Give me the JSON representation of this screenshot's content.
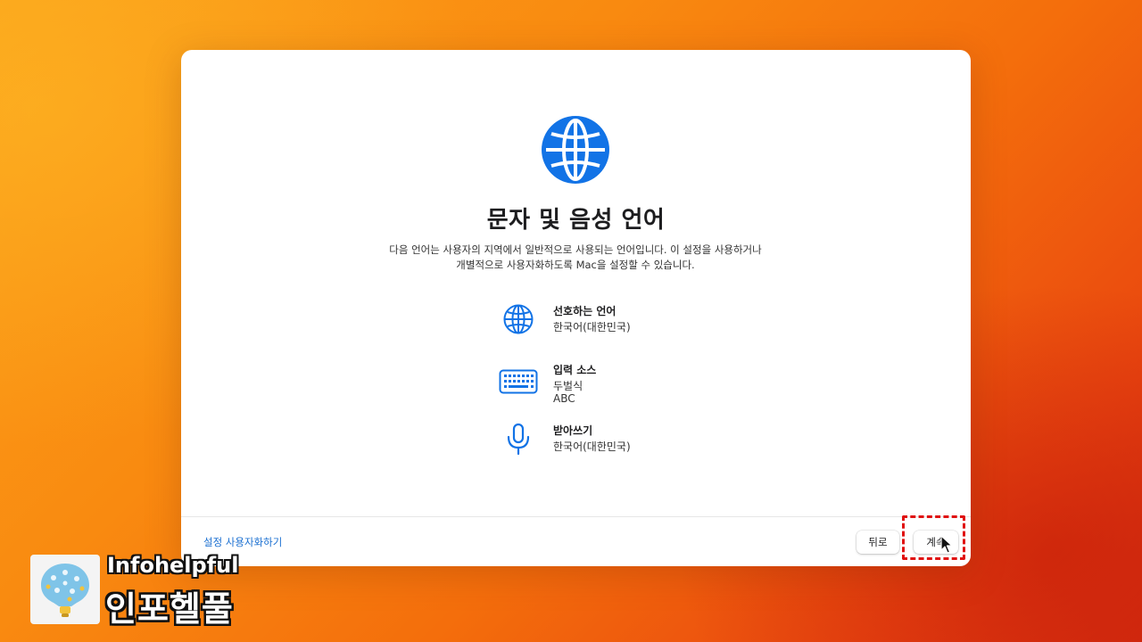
{
  "window": {
    "icon": "globe-icon",
    "title": "문자 및 음성 언어",
    "description_line1": "다음 언어는 사용자의 지역에서 일반적으로 사용되는 언어입니다. 이 설정을 사용하거나",
    "description_line2": "개별적으로 사용자화하도록 Mac을 설정할 수 있습니다."
  },
  "settings": [
    {
      "icon": "globe-icon",
      "label": "선호하는 언어",
      "values": [
        "한국어(대한민국)"
      ]
    },
    {
      "icon": "keyboard-icon",
      "label": "입력 소스",
      "values": [
        "두벌식",
        "ABC"
      ]
    },
    {
      "icon": "microphone-icon",
      "label": "받아쓰기",
      "values": [
        "한국어(대한민국)"
      ]
    }
  ],
  "footer": {
    "customize_link": "설정 사용자화하기",
    "back_label": "뒤로",
    "continue_label": "계속"
  },
  "watermark": {
    "brand_en": "Infohelpful",
    "brand_ko": "인포헬풀"
  },
  "colors": {
    "accent": "#1a6fd1",
    "icon_blue": "#1273e6",
    "highlight": "#e01010"
  }
}
